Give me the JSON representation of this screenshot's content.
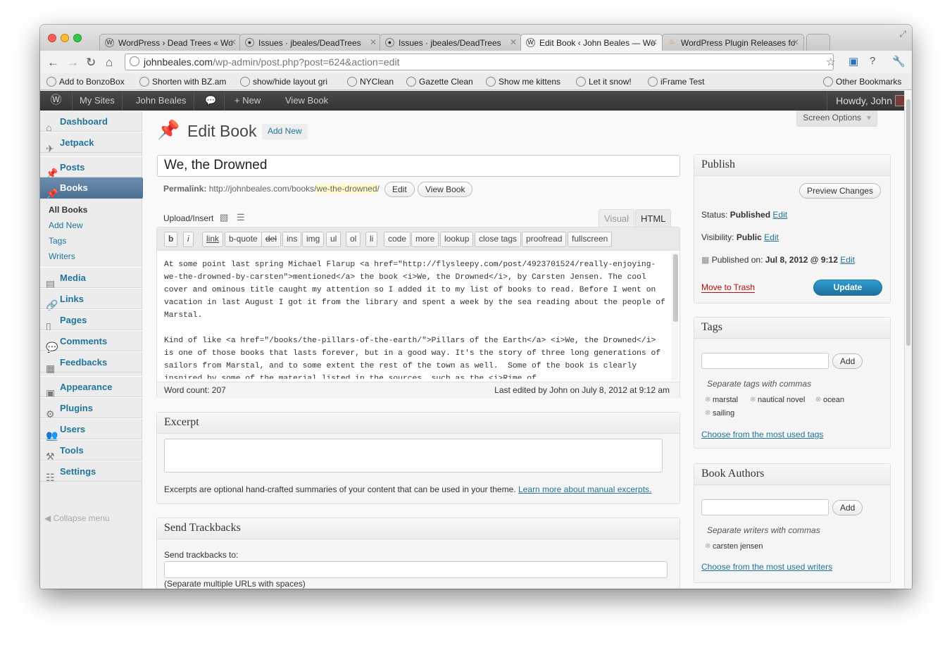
{
  "browser": {
    "tabs": [
      {
        "title": "WordPress › Dead Trees « Wo",
        "icon": "wordpress-icon"
      },
      {
        "title": "Issues · jbeales/DeadTrees",
        "icon": "github-icon"
      },
      {
        "title": "Issues · jbeales/DeadTrees",
        "icon": "github-icon"
      },
      {
        "title": "Edit Book ‹ John Beales — Wo",
        "icon": "wordpress-icon"
      },
      {
        "title": "WordPress Plugin Releases fo",
        "icon": "flame-icon"
      }
    ],
    "url_host": "johnbeales.com",
    "url_path": "/wp-admin/post.php?post=624&action=edit",
    "bookmarks": [
      "Add to BonzoBox",
      "Shorten with BZ.am",
      "show/hide layout gri",
      "NYClean",
      "Gazette Clean",
      "Show me kittens",
      "Let it snow!",
      "iFrame Test"
    ],
    "other_bookmarks": "Other Bookmarks"
  },
  "adminbar": {
    "my_sites": "My Sites",
    "site_name": "John Beales",
    "new": "+ New",
    "view": "View Book",
    "howdy": "Howdy, John"
  },
  "menu": {
    "dashboard": "Dashboard",
    "jetpack": "Jetpack",
    "posts": "Posts",
    "books": "Books",
    "books_sub": [
      "All Books",
      "Add New",
      "Tags",
      "Writers"
    ],
    "media": "Media",
    "links": "Links",
    "pages": "Pages",
    "comments": "Comments",
    "feedbacks": "Feedbacks",
    "appearance": "Appearance",
    "plugins": "Plugins",
    "users": "Users",
    "tools": "Tools",
    "settings": "Settings",
    "collapse": "Collapse menu"
  },
  "page": {
    "screen_options": "Screen Options",
    "title": "Edit Book",
    "add_new": "Add New",
    "post_title": "We, the Drowned",
    "permalink_label": "Permalink:",
    "permalink_base": "http://johnbeales.com/books/",
    "permalink_slug": "we-the-drowned",
    "permalink_end": "/",
    "edit_btn": "Edit",
    "view_btn": "View Book",
    "upload_insert": "Upload/Insert",
    "tab_visual": "Visual",
    "tab_html": "HTML",
    "quicktags": [
      "b",
      "i",
      "link",
      "b-quote",
      "del",
      "ins",
      "img",
      "ul",
      "ol",
      "li",
      "code",
      "more",
      "lookup",
      "close tags",
      "proofread",
      "fullscreen"
    ],
    "content": "At some point last spring Michael Flarup <a href=\"http://flysleepy.com/post/4923701524/really-enjoying-we-the-drowned-by-carsten\">mentioned</a> the book <i>We, the Drowned</i>, by Carsten Jensen. The cool cover and ominous title caught my attention so I added it to my list of books to read. Before I went on vacation in last August I got it from the library and spent a week by the sea reading about the people of Marstal.\n\nKind of like <a href=\"/books/the-pillars-of-the-earth/\">Pillars of the Earth</a> <i>We, the Drowned</i> is one of those books that lasts forever, but in a good way. It's the story of three long generations of sailors from Marstal, and to some extent the rest of the town as well.  Some of the book is clearly inspired by some of the material listed in the sources, such as the <i>Rime of",
    "word_count": "Word count: 207",
    "last_edited": "Last edited by John on July 8, 2012 at 9:12 am"
  },
  "excerpt": {
    "heading": "Excerpt",
    "help": "Excerpts are optional hand-crafted summaries of your content that can be used in your theme.",
    "help_link": "Learn more about manual excerpts."
  },
  "trackbacks": {
    "heading": "Send Trackbacks",
    "label": "Send trackbacks to:",
    "note": "(Separate multiple URLs with spaces)"
  },
  "publish": {
    "heading": "Publish",
    "preview": "Preview Changes",
    "status_label": "Status:",
    "status_value": "Published",
    "visibility_label": "Visibility:",
    "visibility_value": "Public",
    "published_label": "Published on:",
    "published_value": "Jul 8, 2012 @ 9:12",
    "edit": "Edit",
    "trash": "Move to Trash",
    "update": "Update"
  },
  "tags": {
    "heading": "Tags",
    "add": "Add",
    "hint": "Separate tags with commas",
    "items": [
      "marstal",
      "nautical novel",
      "ocean",
      "sailing"
    ],
    "most_used": "Choose from the most used tags"
  },
  "authors": {
    "heading": "Book Authors",
    "add": "Add",
    "hint": "Separate writers with commas",
    "items": [
      "carsten jensen"
    ],
    "most_used": "Choose from the most used writers"
  }
}
